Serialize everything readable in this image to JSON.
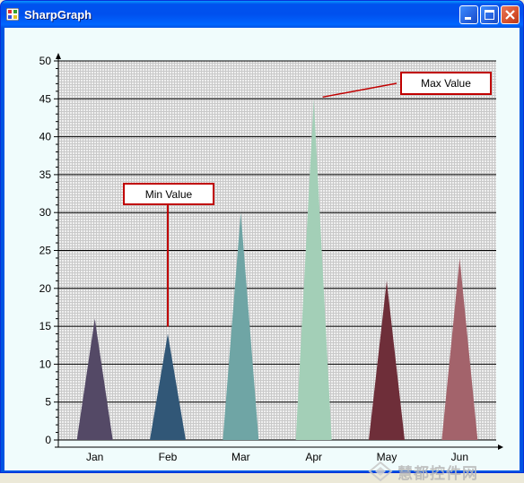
{
  "window": {
    "title": "SharpGraph"
  },
  "chart_data": {
    "type": "bar",
    "style": "triangle-peaks",
    "categories": [
      "Jan",
      "Feb",
      "Mar",
      "Apr",
      "May",
      "Jun"
    ],
    "values": [
      16,
      14,
      30,
      45,
      21,
      24
    ],
    "colors": [
      "#544966",
      "#315777",
      "#6fa5a5",
      "#a3cfb7",
      "#6e2e39",
      "#a3636b"
    ],
    "ylim": [
      0,
      50
    ],
    "yticks": [
      0,
      5,
      10,
      15,
      20,
      25,
      30,
      35,
      40,
      45,
      50
    ],
    "grid": true,
    "annotations": [
      {
        "text": "Min Value",
        "target": "Feb"
      },
      {
        "text": "Max Value",
        "target": "Apr"
      }
    ]
  },
  "watermark": {
    "text": "慧都控件网"
  }
}
